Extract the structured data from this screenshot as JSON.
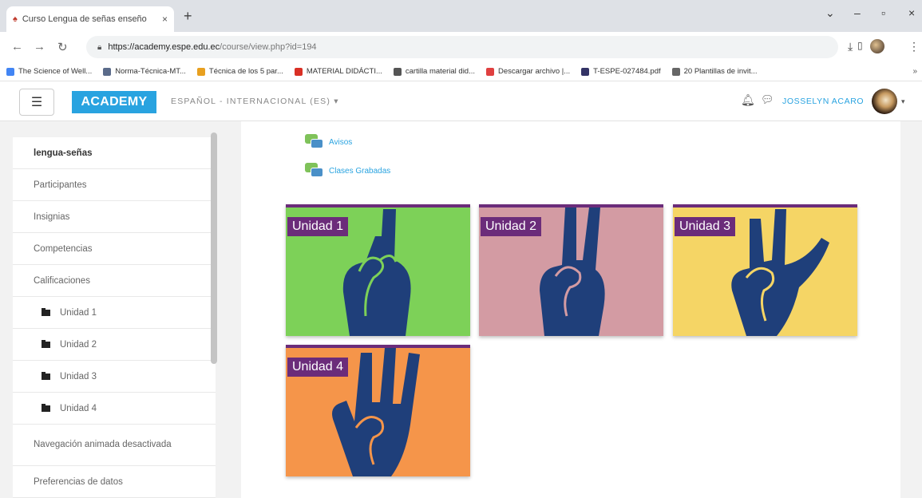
{
  "browser": {
    "tab_title": "Curso Lengua de señas enseño",
    "tab_close": "×",
    "new_tab": "+",
    "url_host": "https://academy.espe.edu.ec",
    "url_path": "/course/view.php?id=194",
    "bookmarks": [
      {
        "label": "The Science of Well...",
        "color": "#4285f4"
      },
      {
        "label": "Norma-Técnica-MT...",
        "color": "#5b6b8a"
      },
      {
        "label": "Técnica de los 5 par...",
        "color": "#e8a020"
      },
      {
        "label": "MATERIAL DIDÁCTI...",
        "color": "#d93025"
      },
      {
        "label": "cartilla material did...",
        "color": "#555555"
      },
      {
        "label": "Descargar archivo |...",
        "color": "#e04040"
      },
      {
        "label": "T-ESPE-027484.pdf",
        "color": "#333366"
      },
      {
        "label": "20 Plantillas de invit...",
        "color": "#666666"
      }
    ],
    "bookmarks_more": "»"
  },
  "navbar": {
    "brand": "ACADEMY",
    "language": "ESPAÑOL - INTERNACIONAL (ES) ▾",
    "username": "JOSSELYN ACARO",
    "avatar_caret": "▾"
  },
  "sidebar": {
    "items": [
      {
        "label": "lengua-señas",
        "active": true
      },
      {
        "label": "Participantes"
      },
      {
        "label": "Insignias"
      },
      {
        "label": "Competencias"
      },
      {
        "label": "Calificaciones"
      },
      {
        "label": "Unidad 1",
        "folder": true
      },
      {
        "label": "Unidad 2",
        "folder": true
      },
      {
        "label": "Unidad 3",
        "folder": true
      },
      {
        "label": "Unidad 4",
        "folder": true
      },
      {
        "label": "Navegación animada desactivada",
        "tall": true
      },
      {
        "label": "Preferencias de datos"
      }
    ]
  },
  "main": {
    "links": [
      {
        "label": "Avisos"
      },
      {
        "label": "Clases Grabadas"
      }
    ],
    "units": [
      {
        "label": "Unidad 1",
        "bg": "#7dd158"
      },
      {
        "label": "Unidad 2",
        "bg": "#d39ba3"
      },
      {
        "label": "Unidad 3",
        "bg": "#f5d565"
      },
      {
        "label": "Unidad 4",
        "bg": "#f5954a"
      }
    ]
  },
  "colors": {
    "accent": "#29a3e0",
    "card_label": "#6b2c7a",
    "hand": "#1f3f7a"
  }
}
